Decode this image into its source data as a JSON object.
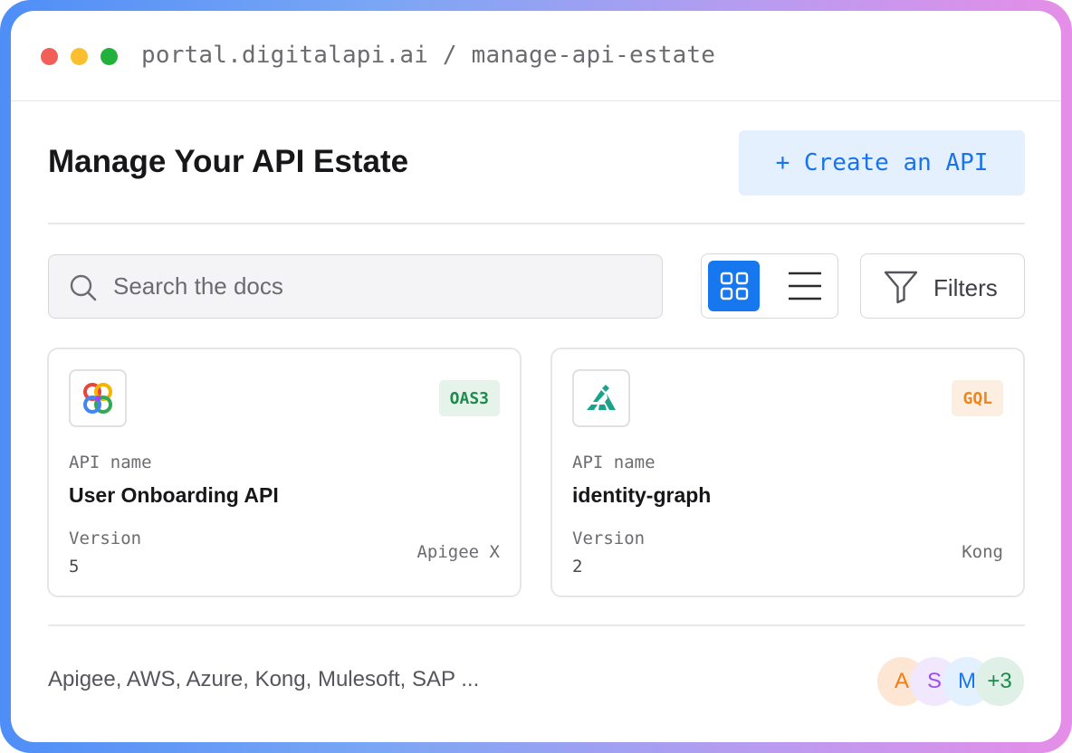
{
  "window": {
    "url": "portal.digitalapi.ai / manage-api-estate"
  },
  "header": {
    "title": "Manage Your API Estate",
    "create_label": "+ Create an API"
  },
  "toolbar": {
    "search_placeholder": "Search the docs",
    "view_mode": "grid",
    "filters_label": "Filters"
  },
  "cards": [
    {
      "logo_icon": "multicolor-knot-logo-icon",
      "spec": "OAS3",
      "name_label": "API name",
      "name": "User Onboarding API",
      "version_label": "Version",
      "version": "5",
      "gateway": "Apigee X"
    },
    {
      "logo_icon": "kong-logo-icon",
      "spec": "GQL",
      "name_label": "API name",
      "name": "identity-graph",
      "version_label": "Version",
      "version": "2",
      "gateway": "Kong"
    }
  ],
  "footer": {
    "providers": "Apigee, AWS, Azure, Kong, Mulesoft, SAP ...",
    "avatars": [
      "A",
      "S",
      "M",
      "+3"
    ]
  },
  "colors": {
    "accent": "#1677ee",
    "create_bg": "#e4f0fd",
    "oas_badge": "#1f8a4c",
    "gql_badge": "#f0861a"
  }
}
